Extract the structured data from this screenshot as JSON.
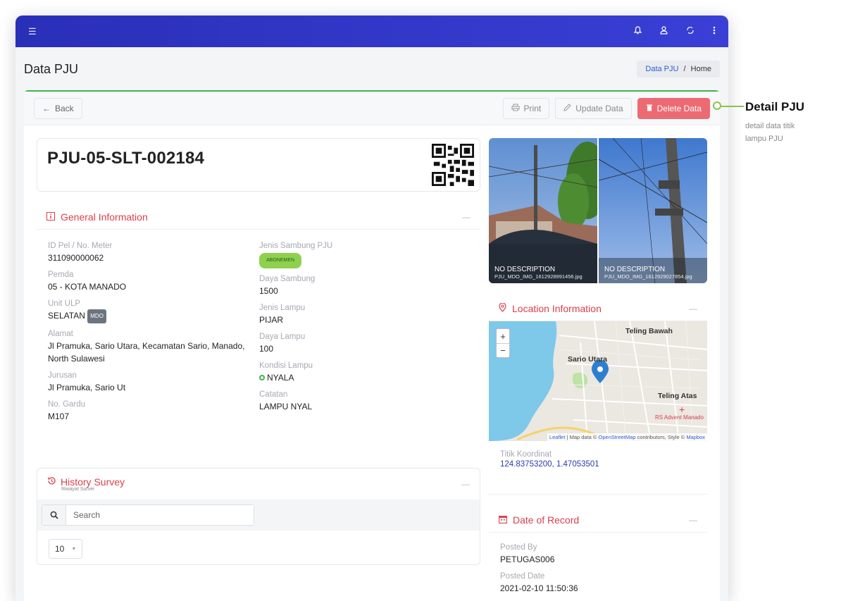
{
  "topbar": {
    "menu_icon": "menu-icon",
    "icons": [
      "bell-icon",
      "user-icon",
      "sync-icon",
      "more-vertical-icon"
    ]
  },
  "page": {
    "title": "Data PJU"
  },
  "breadcrumb": {
    "link": "Data PJU",
    "separator": "/",
    "current": "Home"
  },
  "toolbar": {
    "back": "Back",
    "print": "Print",
    "update": "Update Data",
    "delete": "Delete Data"
  },
  "pju": {
    "id": "PJU-05-SLT-002184"
  },
  "general": {
    "title": "General Information",
    "collapse": "—",
    "id_pel_label": "ID Pel / No. Meter",
    "id_pel_value": "311090000062",
    "pemda_label": "Pemda",
    "pemda_value": "05 - KOTA MANADO",
    "ulp_label": "Unit ULP",
    "ulp_value": "SELATAN",
    "ulp_badge": "MDO",
    "alamat_label": "Alamat",
    "alamat_value": "Jl Pramuka, Sario Utara, Kecamatan Sario, Manado, North Sulawesi",
    "jurusan_label": "Jurusan",
    "jurusan_value": "Jl Pramuka, Sario Ut",
    "gardu_label": "No. Gardu",
    "gardu_value": "M107",
    "jenis_sambung_label": "Jenis Sambung PJU",
    "jenis_sambung_value": "ABONEMEN",
    "daya_sambung_label": "Daya Sambung",
    "daya_sambung_value": "1500",
    "jenis_lampu_label": "Jenis Lampu",
    "jenis_lampu_value": "PIJAR",
    "daya_lampu_label": "Daya Lampu",
    "daya_lampu_value": "100",
    "kondisi_label": "Kondisi Lampu",
    "kondisi_value": "NYALA",
    "catatan_label": "Catatan",
    "catatan_value": "LAMPU NYAL"
  },
  "history": {
    "title": "History Survey",
    "subtitle": "Riwayat Survei",
    "collapse": "—",
    "search_placeholder": "Search",
    "page_size": "10"
  },
  "photos": [
    {
      "desc": "NO DESCRIPTION",
      "file": "PJU_MDO_IMG_1612928991456.jpg"
    },
    {
      "desc": "NO DESCRIPTION",
      "file": "PJU_MDO_IMG_1612929027854.jpg"
    }
  ],
  "location": {
    "title": "Location Information",
    "collapse": "—",
    "zoom_in": "+",
    "zoom_out": "−",
    "labels": [
      "Teling Bawah",
      "Sario Utara",
      "Teling Atas",
      "RS Advent Manado"
    ],
    "attribution": {
      "leaflet": "Leaflet",
      "map_data": " | Map data © ",
      "osm": "OpenStreetMap",
      "contrib": " contributors, Style © ",
      "mapbox": "Mapbox"
    },
    "coord_label": "Titik Koordinat",
    "coord_value": "124.83753200, 1.47053501"
  },
  "record": {
    "title": "Date of Record",
    "collapse": "—",
    "posted_by_label": "Posted By",
    "posted_by_value": "PETUGAS006",
    "posted_date_label": "Posted Date",
    "posted_date_value": "2021-02-10 11:50:36"
  },
  "annotation": {
    "title": "Detail PJU",
    "desc": "detail data titik lampu PJU"
  },
  "colors": {
    "topbar": "#2a2fb8",
    "accent_red": "#d9404b",
    "success": "#3cb54a",
    "danger_btn": "#ec6a72",
    "link_blue": "#2d5fd0"
  }
}
